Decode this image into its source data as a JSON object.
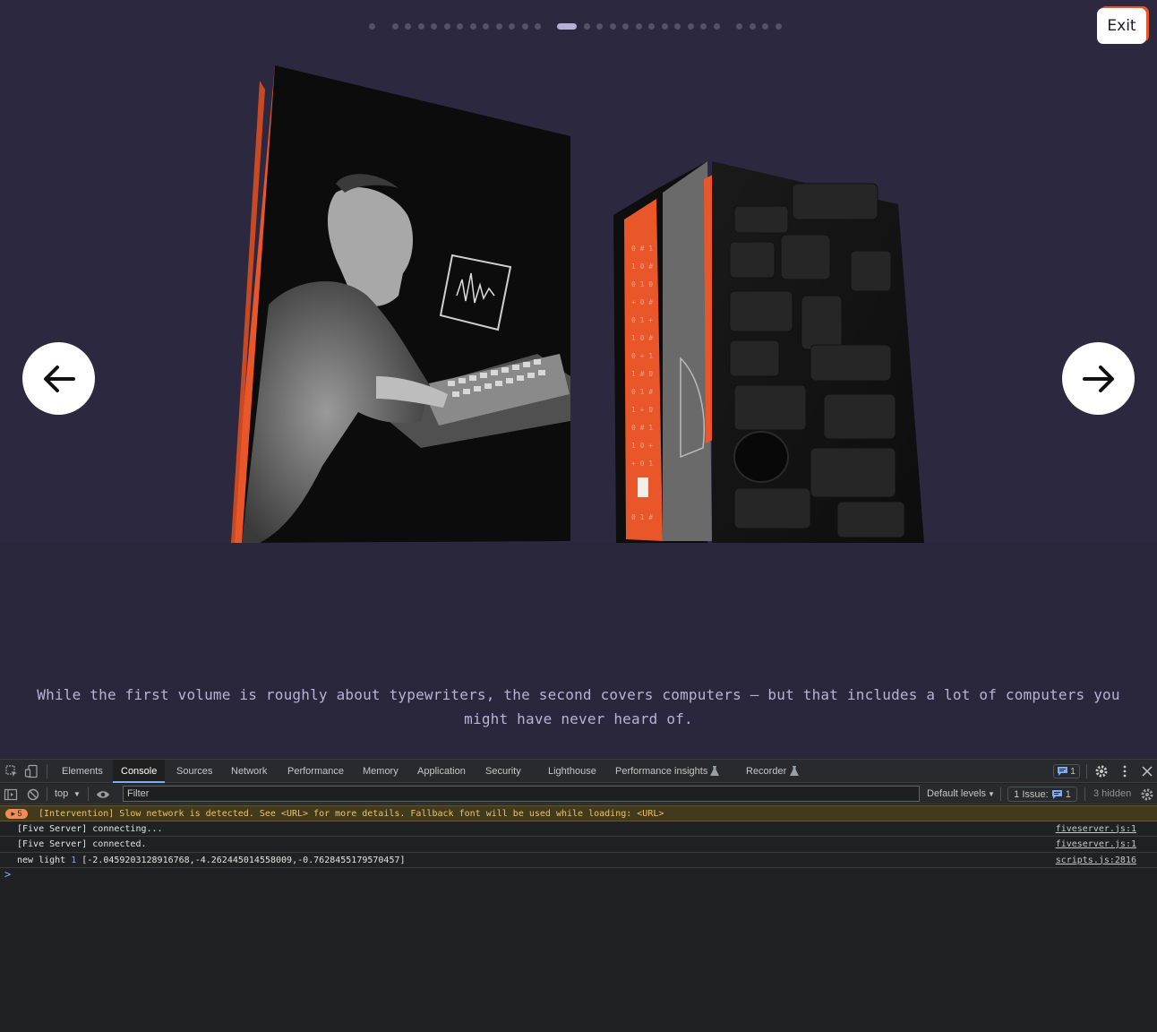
{
  "slideshow": {
    "dot_count": 30,
    "active_dot_index": 14,
    "exit_label": "Exit",
    "prev_icon": "arrow-left-icon",
    "next_icon": "arrow-right-icon",
    "caption": "While the first volume is roughly about typewriters, the second covers computers – but that includes a lot of computers you might have never heard of.",
    "colors": {
      "background": "#2c2840",
      "accent": "#e8562a",
      "caption": "#b8b3d4"
    }
  },
  "devtools": {
    "tabs": [
      {
        "label": "Elements",
        "active": false
      },
      {
        "label": "Console",
        "active": true
      },
      {
        "label": "Sources",
        "active": false
      },
      {
        "label": "Network",
        "active": false
      },
      {
        "label": "Performance",
        "active": false
      },
      {
        "label": "Memory",
        "active": false
      },
      {
        "label": "Application",
        "active": false
      },
      {
        "label": "Security",
        "active": false
      },
      {
        "label": "Lighthouse",
        "active": false
      },
      {
        "label": "Performance insights",
        "active": false
      },
      {
        "label": "Recorder",
        "active": false
      }
    ],
    "message_count": "1",
    "toolbar": {
      "context": "top",
      "filter_placeholder": "Filter",
      "levels": "Default levels",
      "issues_label": "1 Issue:",
      "issues_count": "1",
      "hidden": "3 hidden"
    },
    "console": {
      "warning": {
        "count": "5",
        "text": "[Intervention] Slow network is detected. See <URL> for more details. Fallback font will be used while loading: <URL>"
      },
      "logs": [
        {
          "text": "[Five Server] connecting...",
          "source": "fiveserver.js:1"
        },
        {
          "text": "[Five Server] connected.",
          "source": "fiveserver.js:1"
        },
        {
          "prefix": "new light ",
          "number": "1",
          "rest": " [-2.0459203128916768,-4.262445014558009,-0.7628455179570457]",
          "source": "scripts.js:2816"
        }
      ],
      "prompt": ">"
    }
  }
}
